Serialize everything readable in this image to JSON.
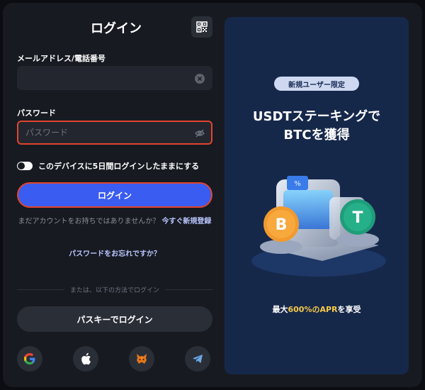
{
  "login": {
    "title": "ログイン",
    "email_label": "メールアドレス/電話番号",
    "email_value": "",
    "password_label": "パスワード",
    "password_placeholder": "パスワード",
    "stay_logged_in_label": "このデバイスに5日間ログインしたままにする",
    "login_button": "ログイン",
    "no_account_text": "まだアカウントをお持ちではありませんか？",
    "register_link": "今すぐ新規登録",
    "forgot_link": "パスワードをお忘れですか？",
    "divider_text": "または、以下の方法でログイン",
    "passkey_button": "パスキーでログイン",
    "social_icons": [
      "google-icon",
      "apple-icon",
      "metamask-icon",
      "telegram-icon"
    ]
  },
  "promo": {
    "badge": "新規ユーザー限定",
    "title_line1": "USDTステーキングで",
    "title_line2": "BTCを獲得",
    "apr_prefix": "最大",
    "apr_value": "600%のAPR",
    "apr_suffix": "を享受"
  },
  "colors": {
    "background": "#171a21",
    "primary_button": "#3a5cf0",
    "focus_outline": "#e0452f",
    "link": "#b9c6ff",
    "promo_bg": "#16284a",
    "apr_highlight": "#f7c948"
  }
}
